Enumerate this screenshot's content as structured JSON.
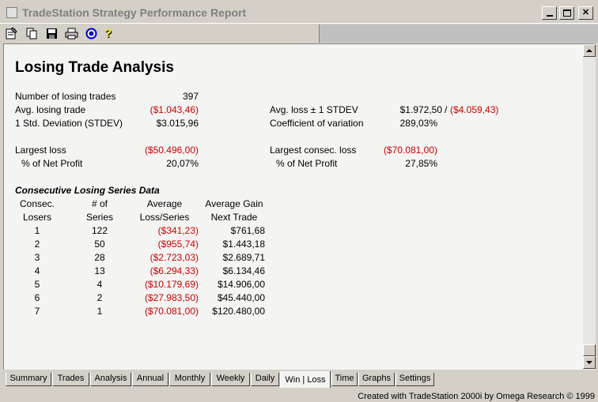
{
  "window": {
    "title": "TradeStation Strategy Performance Report"
  },
  "toolbar": {
    "icons": [
      "properties-icon",
      "copy-icon",
      "save-icon",
      "print-icon",
      "target-icon",
      "help-icon"
    ]
  },
  "report": {
    "heading": "Losing Trade Analysis",
    "stats_left": [
      {
        "label": "Number of losing trades",
        "value": "397",
        "negative": false
      },
      {
        "label": "Avg. losing trade",
        "value": "($1.043,46)",
        "negative": true
      },
      {
        "label": "1 Std. Deviation (STDEV)",
        "value": "$3.015,96",
        "negative": false
      }
    ],
    "stats_right": {
      "avg_loss_label": "Avg. loss ± 1 STDEV",
      "avg_loss_value_high": "$1.972,50",
      "avg_loss_separator": "/",
      "avg_loss_value_low": "($4.059,43)",
      "coef_label": "Coefficient of variation",
      "coef_value": "289,03%"
    },
    "largest_loss_label": "Largest loss",
    "largest_loss_value": "($50.496,00)",
    "largest_loss_pct_label": "% of Net Profit",
    "largest_loss_pct_value": "20,07%",
    "largest_consec_label": "Largest consec. loss",
    "largest_consec_value": "($70.081,00)",
    "largest_consec_pct_label": "% of Net Profit",
    "largest_consec_pct_value": "27,85%",
    "series_title": "Consecutive Losing Series Data",
    "columns": {
      "c1_line1": "Consec.",
      "c1_line2": "Losers",
      "c2_line1": "# of",
      "c2_line2": "Series",
      "c3_line1": "Average",
      "c3_line2": "Loss/Series",
      "c4_line1": "Average Gain",
      "c4_line2": "Next Trade"
    },
    "rows": [
      {
        "losers": "1",
        "series": "122",
        "loss": "($341,23)",
        "gain": "$761,68"
      },
      {
        "losers": "2",
        "series": "50",
        "loss": "($955,74)",
        "gain": "$1.443,18"
      },
      {
        "losers": "3",
        "series": "28",
        "loss": "($2.723,03)",
        "gain": "$2.689,71"
      },
      {
        "losers": "4",
        "series": "13",
        "loss": "($6.294,33)",
        "gain": "$6.134,46"
      },
      {
        "losers": "5",
        "series": "4",
        "loss": "($10.179,69)",
        "gain": "$14.906,00"
      },
      {
        "losers": "6",
        "series": "2",
        "loss": "($27.983,50)",
        "gain": "$45.440,00"
      },
      {
        "losers": "7",
        "series": "1",
        "loss": "($70.081,00)",
        "gain": "$120.480,00"
      }
    ]
  },
  "tabs": [
    {
      "label": "Summary",
      "active": false
    },
    {
      "label": "Trades",
      "active": false
    },
    {
      "label": "Analysis",
      "active": false
    },
    {
      "label": "Annual",
      "active": false
    },
    {
      "label": "Monthly",
      "active": false
    },
    {
      "label": "Weekly",
      "active": false
    },
    {
      "label": "Daily",
      "active": false
    },
    {
      "label": "Win | Loss",
      "active": true
    },
    {
      "label": "Time",
      "active": false
    },
    {
      "label": "Graphs",
      "active": false
    },
    {
      "label": "Settings",
      "active": false
    }
  ],
  "footer": "Created with TradeStation 2000i by Omega Research © 1999",
  "colors": {
    "negative": "#cc0000",
    "chrome": "#d4d0c8",
    "report_bg": "#f4f4f2"
  }
}
